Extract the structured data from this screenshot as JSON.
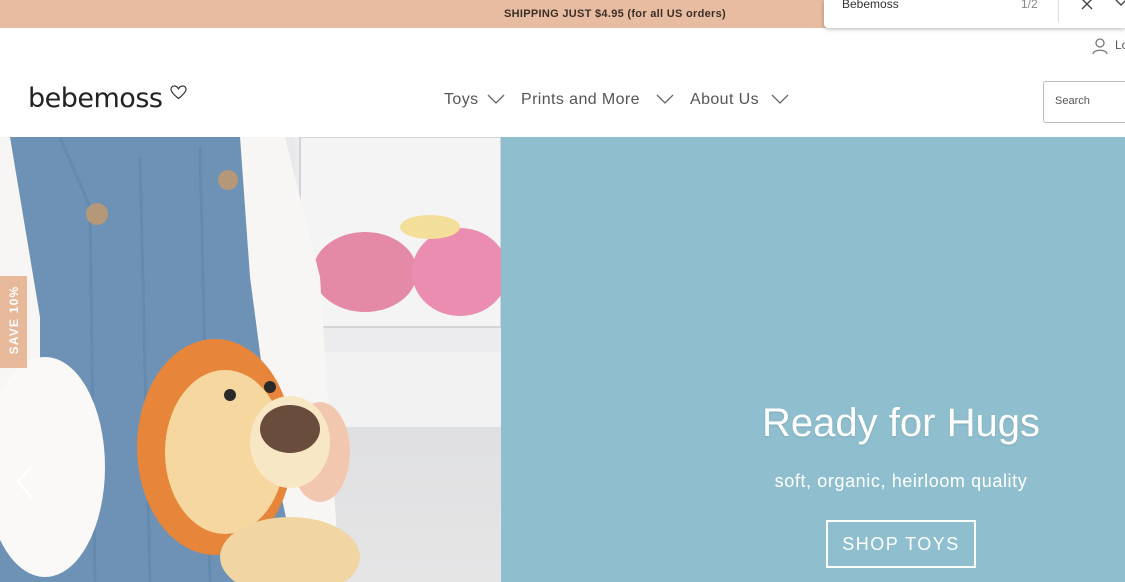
{
  "promo": {
    "text": "SHIPPING JUST $4.95 (for all US orders)"
  },
  "find_bar": {
    "query": "Bebemoss",
    "count": "1/2"
  },
  "account": {
    "login_label": "Lo"
  },
  "brand": {
    "logo_text": "bebemoss"
  },
  "nav": [
    {
      "label": "Toys"
    },
    {
      "label": "Prints and More"
    },
    {
      "label": "About Us"
    }
  ],
  "search": {
    "placeholder": "Search"
  },
  "hero": {
    "title": "Ready for Hugs",
    "subtitle": "soft, organic, heirloom quality",
    "cta": "SHOP TOYS"
  },
  "save_tab": {
    "label": "SAVE 10%"
  },
  "colors": {
    "promo_bg": "#e8bca0",
    "hero_bg": "#8fbfcf",
    "save_tab": "#e8b89b"
  },
  "icons": [
    "close-icon",
    "chevron-down-icon",
    "user-icon",
    "heart-icon",
    "chevron-left-icon"
  ]
}
